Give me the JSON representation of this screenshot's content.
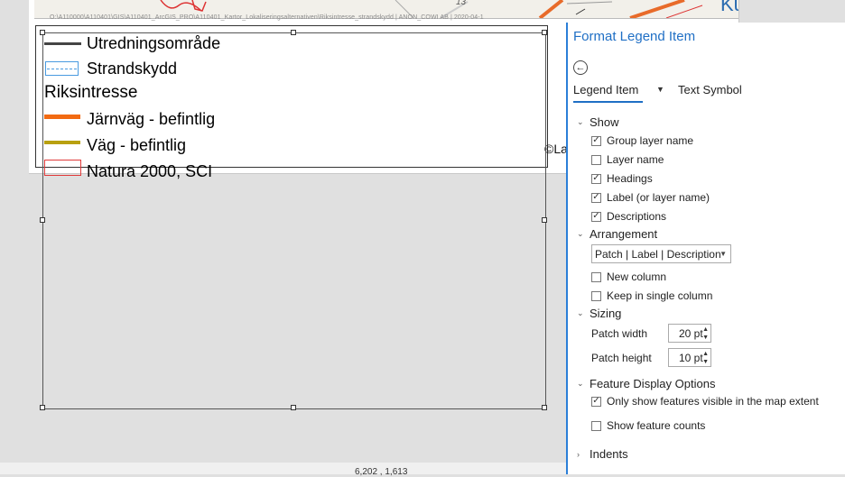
{
  "map": {
    "path_text": "O:\\A110000\\A110401\\GIS\\A110401_ArcGIS_PRO\\A110401_Kartor_Lokaliseringsalternativen\\Riksintresse_strandskydd | ANON_COWI AB | 2020-04-1",
    "place_label": "Kung",
    "road_number": "13",
    "copyright": "©La"
  },
  "legend": {
    "items": [
      {
        "label": "Utredningsområde",
        "patch": "dark-line",
        "color": "#444444"
      },
      {
        "label": "Strandskydd",
        "patch": "dashed-blue-box",
        "color": "#4a9be0"
      },
      {
        "label": "Järnväg - befintlig",
        "patch": "thick-line",
        "color": "#f26a12"
      },
      {
        "label": "Väg - befintlig",
        "patch": "thick-line",
        "color": "#b8a010"
      },
      {
        "label": "Natura 2000, SCI",
        "patch": "red-box",
        "color": "#e03a3a"
      }
    ],
    "heading": "Riksintresse"
  },
  "status": {
    "coords": "6,202 , 1,613"
  },
  "pane": {
    "title": "Format Legend Item",
    "back_icon": "back-arrow-icon",
    "tabs": [
      "Legend Item",
      "Text Symbol"
    ],
    "sections": {
      "show": "Show",
      "arrangement": "Arrangement",
      "sizing": "Sizing",
      "feature_display": "Feature Display Options",
      "indents": "Indents"
    },
    "show_options": [
      {
        "label": "Group layer name",
        "checked": true
      },
      {
        "label": "Layer name",
        "checked": false
      },
      {
        "label": "Headings",
        "checked": true
      },
      {
        "label": "Label (or layer name)",
        "checked": true
      },
      {
        "label": "Descriptions",
        "checked": true
      }
    ],
    "arrangement_value": "Patch | Label | Description",
    "arrangement_options": [
      {
        "label": "New column",
        "checked": false
      },
      {
        "label": "Keep in single column",
        "checked": false
      }
    ],
    "sizing": {
      "patch_width_label": "Patch width",
      "patch_width": "20 pt",
      "patch_height_label": "Patch height",
      "patch_height": "10 pt"
    },
    "feature_options": [
      {
        "label": "Only show features visible in the map extent",
        "checked": true
      },
      {
        "label": "Show feature counts",
        "checked": false
      }
    ],
    "accent": "#1f6fc5"
  }
}
